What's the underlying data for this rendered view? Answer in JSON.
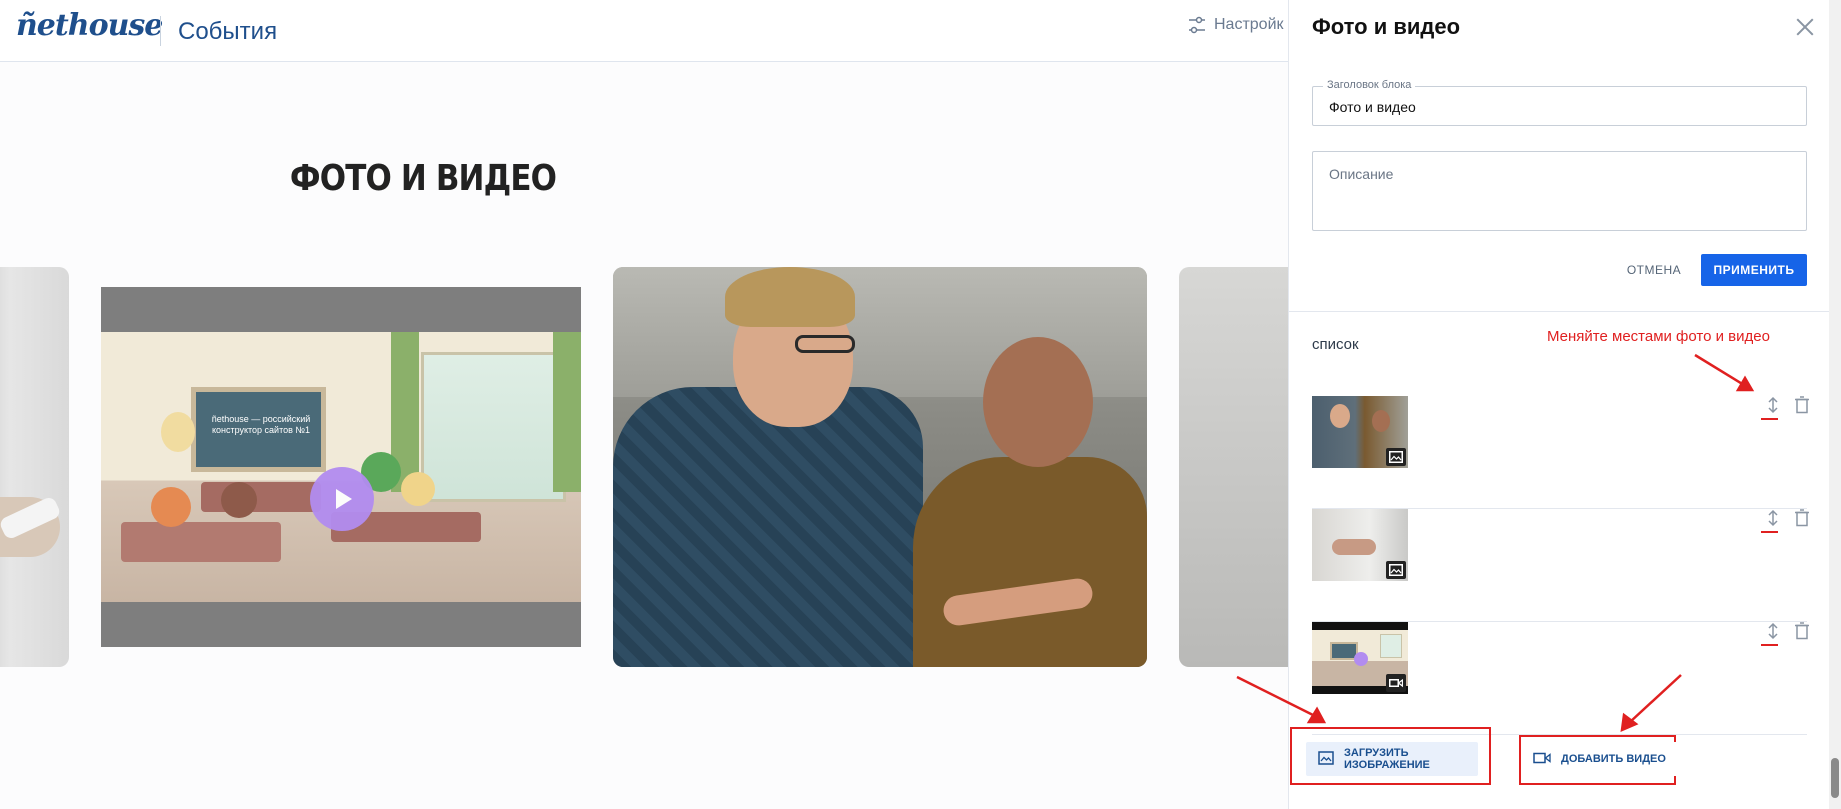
{
  "header": {
    "logo_text": "ñethouse",
    "section": "События",
    "settings_label": "Настройк"
  },
  "preview": {
    "block_heading": "ФОТО И ВИДЕО",
    "video_board_text": "ñethouse — российский конструктор сайтов №1"
  },
  "panel": {
    "title": "Фото и видео",
    "title_field_label": "Заголовок блока",
    "title_field_value": "Фото и видео",
    "description_placeholder": "Описание",
    "cancel_label": "ОТМЕНА",
    "apply_label": "ПРИМЕНИТЬ",
    "list_label": "список",
    "hint": "Меняйте местами фото и видео",
    "items": [
      {
        "type": "image"
      },
      {
        "type": "image"
      },
      {
        "type": "video"
      }
    ],
    "upload_image_label": "ЗАГРУЗИТЬ ИЗОБРАЖЕНИЕ",
    "add_video_label": "ДОБАВИТЬ ВИДЕО"
  },
  "colors": {
    "brand": "#1f4f8c",
    "accent": "#1664e8",
    "annotation": "#e02020"
  }
}
